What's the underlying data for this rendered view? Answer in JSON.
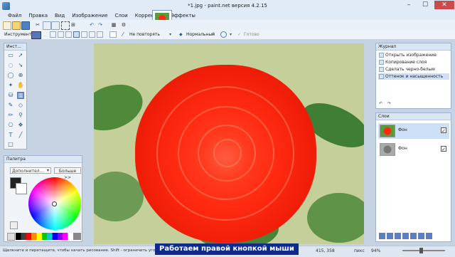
{
  "window": {
    "title": "*1.jpg - paint.net версия 4.2.15",
    "minimize": "–",
    "maximize": "☐",
    "close": "✕"
  },
  "menu": [
    "Файл",
    "Правка",
    "Вид",
    "Изображение",
    "Слои",
    "Коррекция",
    "Эффекты"
  ],
  "toolbar2": {
    "instrument_label": "Инструмент:",
    "repeat_label": "Не повторять",
    "blend_label": "Нормальный",
    "finish_label": "Готово"
  },
  "tools_panel": {
    "title": "Инст..."
  },
  "palette_panel": {
    "title": "Палитра",
    "more_button": "Дополнител...",
    "more_colors_button": "Больше >>"
  },
  "history": {
    "title": "Журнал",
    "items": [
      "Открыть изображение",
      "Копирование слоя",
      "Сделать черно-белым",
      "Оттенок и насыщенность"
    ]
  },
  "layers": {
    "title": "Слои",
    "items": [
      {
        "name": "Фон",
        "checked": "✓"
      },
      {
        "name": "Фон",
        "checked": "✓"
      }
    ]
  },
  "status": {
    "hint": "Щелкните и перетащите, чтобы начать рисование. Shift - ограничить угол",
    "caption": "Работаем правой кнопкой мыши",
    "coords": "415, 358",
    "units": "пикс",
    "zoom": "94%"
  },
  "colors": {
    "primary": "#222222",
    "secondary": "#ffffff",
    "accent": "#0d2a8c",
    "flower": "#ff2a10"
  }
}
